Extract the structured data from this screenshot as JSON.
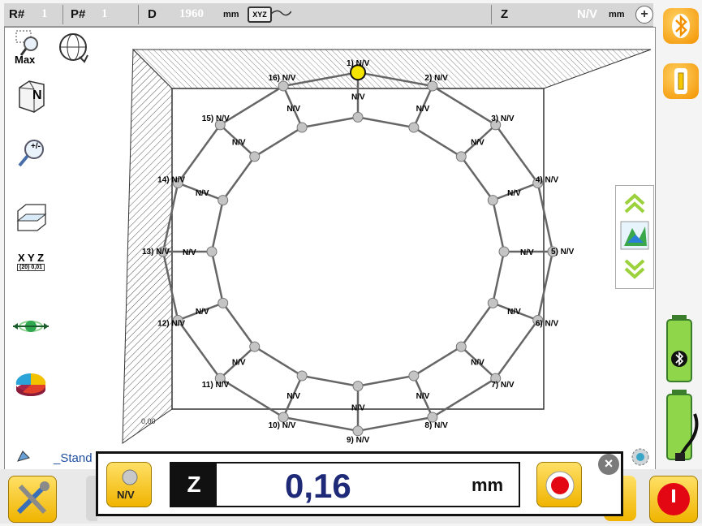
{
  "topbar": {
    "r_label": "R#",
    "r_value": "1",
    "p_label": "P#",
    "p_value": "1",
    "d_label": "D",
    "d_value": "1960",
    "d_unit": "mm",
    "axis_badge": "XYZ",
    "z_label": "Z",
    "z_value": "N/V",
    "z_unit": "mm",
    "plus": "+"
  },
  "sidebar": {
    "zoom_max_label": "Max",
    "north_label": "N",
    "zoom_pm_label": "+/-",
    "xyz_label": "X Y Z",
    "xyz_sub": "(20) 0,01"
  },
  "diagram": {
    "outer_labels": [
      "1) N/V",
      "2) N/V",
      "3) N/V",
      "4) N/V",
      "5) N/V",
      "6) N/V",
      "7) N/V",
      "8) N/V",
      "9) N/V",
      "10) N/V",
      "11) N/V",
      "12) N/V",
      "13) N/V",
      "14) N/V",
      "15) N/V",
      "16) N/V"
    ],
    "inner_label": "N/V",
    "corner_text": "0,00"
  },
  "statusline": {
    "profile_text": "_Stand"
  },
  "popup": {
    "nv_button": "N/V",
    "axis": "Z",
    "value": "0,16",
    "unit": "mm",
    "close": "×"
  },
  "colors": {
    "accent_yellow": "#f5c800",
    "value_blue": "#1e2a78",
    "orange": "#f39200",
    "red": "#e30613"
  }
}
